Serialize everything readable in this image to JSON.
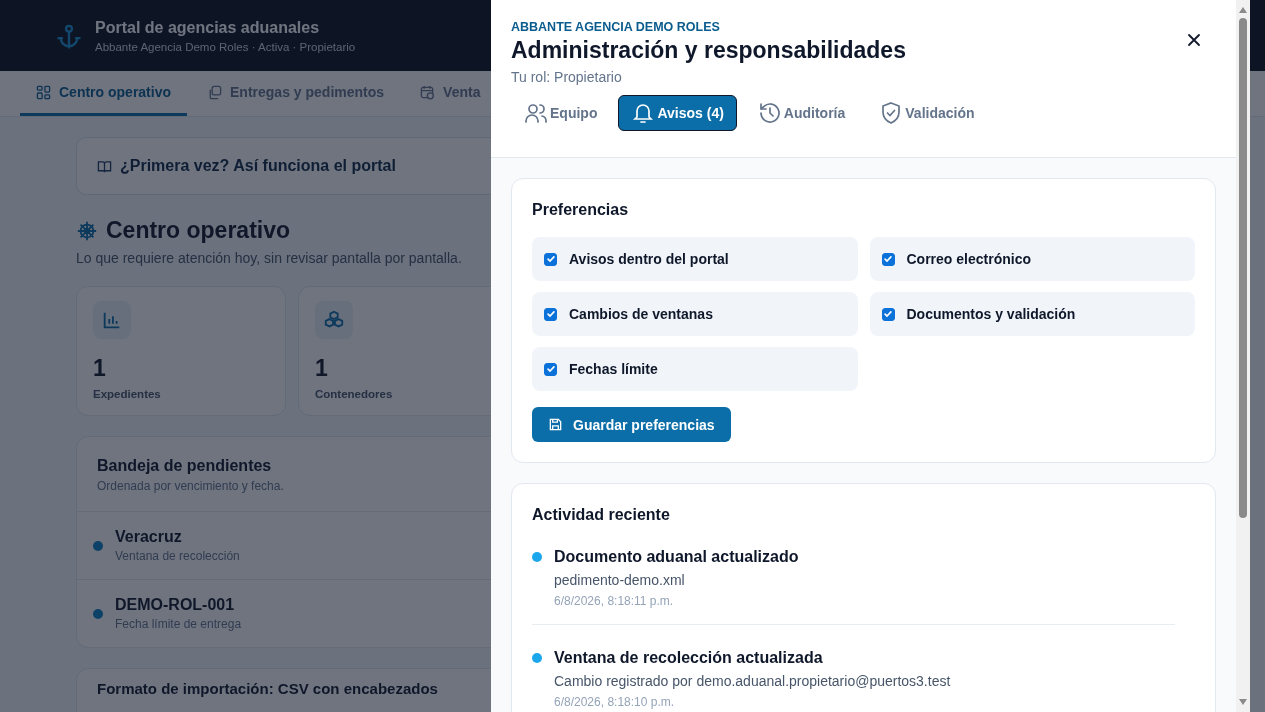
{
  "header": {
    "title": "Portal de agencias aduanales",
    "subtitle": "Abbante Agencia Demo Roles · Activa · Propietario"
  },
  "nav_tabs": [
    {
      "label": "Centro operativo",
      "selected": true
    },
    {
      "label": "Entregas y pedimentos",
      "selected": false
    },
    {
      "label": "Venta",
      "selected": false
    }
  ],
  "guide_banner": "¿Primera vez? Así funciona el portal",
  "page_title": "Centro operativo",
  "page_subtitle": "Lo que requiere atención hoy, sin revisar pantalla por pantalla.",
  "stats": [
    {
      "value": "1",
      "label": "Expedientes"
    },
    {
      "value": "1",
      "label": "Contenedores"
    }
  ],
  "pending": {
    "title": "Bandeja de pendientes",
    "subtitle": "Ordenada por vencimiento y fecha.",
    "items": [
      {
        "title": "Veracruz",
        "subtitle": "Ventana de recolección"
      },
      {
        "title": "DEMO-ROL-001",
        "subtitle": "Fecha límite de entrega"
      }
    ]
  },
  "next_card_title": "Formato de importación: CSV con encabezados",
  "drawer": {
    "eyebrow": "ABBANTE AGENCIA DEMO ROLES",
    "title": "Administración y responsabilidades",
    "role": "Tu rol: Propietario",
    "tabs": [
      {
        "label": "Equipo",
        "selected": false
      },
      {
        "label": "Avisos (4)",
        "selected": true
      },
      {
        "label": "Auditoría",
        "selected": false
      },
      {
        "label": "Validación",
        "selected": false
      }
    ],
    "preferences": {
      "title": "Preferencias",
      "options": [
        {
          "label": "Avisos dentro del portal",
          "checked": true
        },
        {
          "label": "Correo electrónico",
          "checked": true
        },
        {
          "label": "Cambios de ventanas",
          "checked": true
        },
        {
          "label": "Documentos y validación",
          "checked": true
        },
        {
          "label": "Fechas límite",
          "checked": true
        }
      ],
      "save_button": "Guardar preferencias"
    },
    "activity": {
      "title": "Actividad reciente",
      "items": [
        {
          "title": "Documento aduanal actualizado",
          "detail": "pedimento-demo.xml",
          "time": "6/8/2026, 8:18:11 p.m."
        },
        {
          "title": "Ventana de recolección actualizada",
          "detail": "Cambio registrado por demo.aduanal.propietario@puertos3.test",
          "time": "6/8/2026, 8:18:10 p.m."
        }
      ]
    }
  }
}
